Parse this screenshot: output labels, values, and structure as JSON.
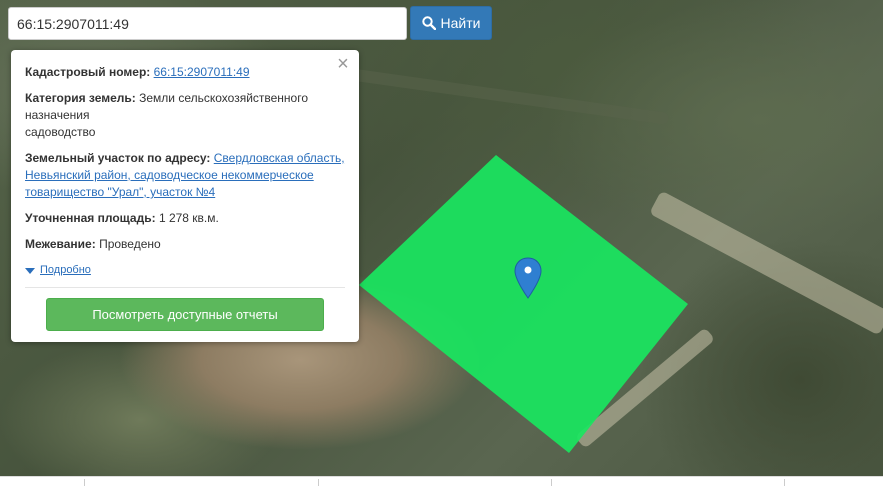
{
  "search": {
    "value": "66:15:2907011:49",
    "button_label": "Найти",
    "button_icon": "search-icon"
  },
  "popup": {
    "cadastral": {
      "label": "Кадастровый номер:",
      "value": "66:15:2907011:49"
    },
    "category": {
      "label": "Категория земель:",
      "value": "Земли сельскохозяйственного назначения",
      "use": "садоводство"
    },
    "address": {
      "label": "Земельный участок по адресу:",
      "value": "Свердловская область, Невьянский район, садоводческое некоммерческое товарищество \"Урал\", участок №4"
    },
    "area": {
      "label": "Уточненная площадь:",
      "value": "1 278 кв.м."
    },
    "survey": {
      "label": "Межевание:",
      "value": "Проведено"
    },
    "details_link": "Подробно",
    "reports_button": "Посмотреть доступные отчеты",
    "close_icon": "close-icon"
  },
  "colors": {
    "parcel_fill": "#19e65f",
    "search_button": "#3379b7",
    "reports_button": "#5cb85c",
    "link": "#2a6ebb",
    "marker": "#2f7fd1"
  }
}
